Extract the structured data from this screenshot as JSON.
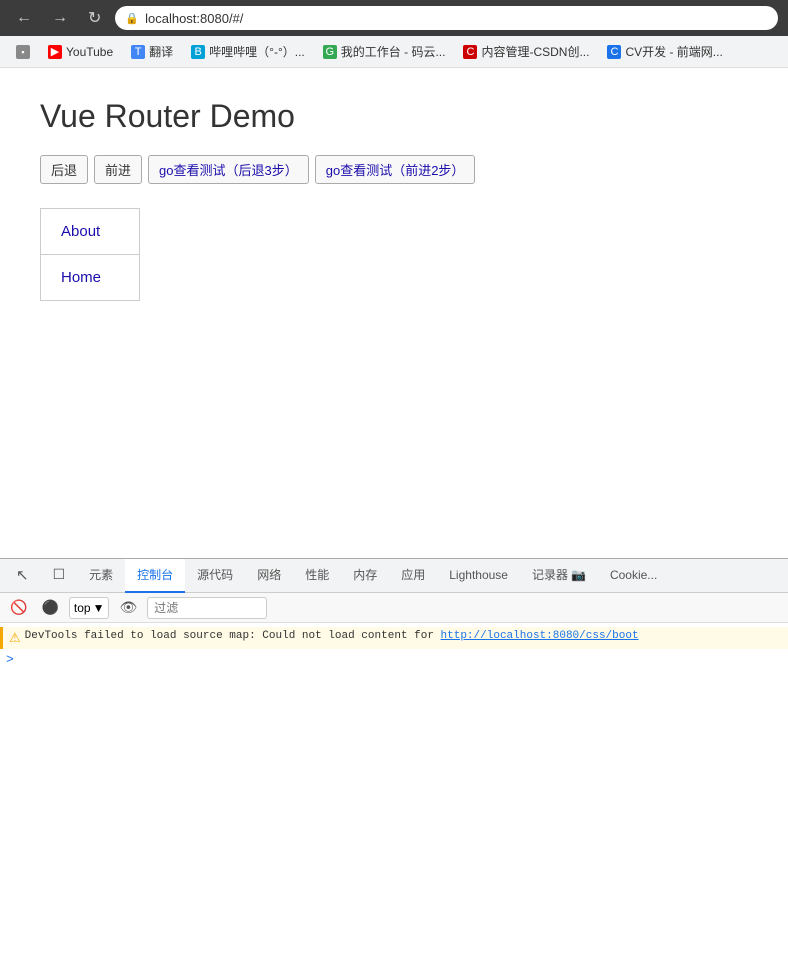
{
  "browser": {
    "url": "localhost:8080/#/",
    "back_title": "Back",
    "forward_title": "Forward",
    "reload_title": "Reload"
  },
  "bookmarks": [
    {
      "id": "apps",
      "label": "",
      "icon": "⊞",
      "color": "bm-apps"
    },
    {
      "id": "youtube",
      "label": "YouTube",
      "icon": "▶",
      "color": "bm-youtube"
    },
    {
      "id": "translate",
      "label": "翻译",
      "icon": "T",
      "color": "bm-translate"
    },
    {
      "id": "bilibili",
      "label": "哔哩哔哩（°-°）...",
      "icon": "B",
      "color": "bm-bilibili"
    },
    {
      "id": "gwork",
      "label": "我的工作台 - 码云...",
      "icon": "G",
      "color": "bm-g"
    },
    {
      "id": "csdn",
      "label": "内容管理-CSDN创...",
      "icon": "C",
      "color": "bm-csdn"
    },
    {
      "id": "cv",
      "label": "CV开发 - 前端网...",
      "icon": "C",
      "color": "bm-cv"
    }
  ],
  "page": {
    "title": "Vue Router Demo",
    "nav_buttons": [
      {
        "id": "back",
        "label": "后退"
      },
      {
        "id": "forward",
        "label": "前进"
      },
      {
        "id": "go-back-3",
        "label": "go查看测试（后退3步）"
      },
      {
        "id": "go-forward-2",
        "label": "go查看测试（前进2步）"
      }
    ],
    "router_links": [
      {
        "id": "about",
        "label": "About",
        "active": true
      },
      {
        "id": "home",
        "label": "Home",
        "active": false
      }
    ]
  },
  "devtools": {
    "tabs": [
      {
        "id": "pointer",
        "label": "",
        "icon": "↖",
        "active": false
      },
      {
        "id": "inspector",
        "label": "",
        "icon": "□",
        "active": false
      },
      {
        "id": "elements",
        "label": "元素",
        "active": false
      },
      {
        "id": "console",
        "label": "控制台",
        "active": true
      },
      {
        "id": "sources",
        "label": "源代码",
        "active": false
      },
      {
        "id": "network",
        "label": "网络",
        "active": false
      },
      {
        "id": "performance",
        "label": "性能",
        "active": false
      },
      {
        "id": "memory",
        "label": "内存",
        "active": false
      },
      {
        "id": "application",
        "label": "应用",
        "active": false
      },
      {
        "id": "lighthouse",
        "label": "Lighthouse",
        "active": false
      },
      {
        "id": "recorder",
        "label": "记录器",
        "active": false
      },
      {
        "id": "cookie",
        "label": "Cookie...",
        "active": false
      }
    ],
    "toolbar": {
      "top_label": "top",
      "filter_placeholder": "过滤"
    },
    "console_messages": [
      {
        "type": "warning",
        "text": "DevTools failed to load source map: Could not load content for ",
        "link": "http://localhost:8080/css/boot",
        "link_suffix": ""
      }
    ],
    "prompt": ">"
  }
}
